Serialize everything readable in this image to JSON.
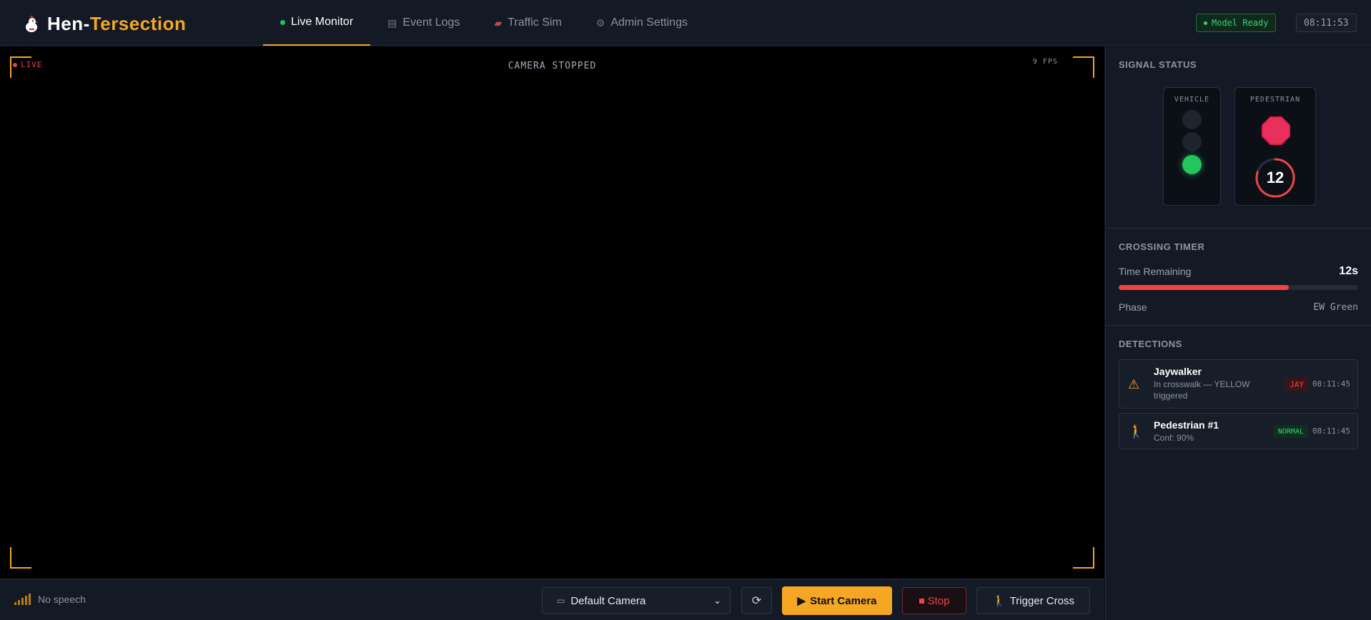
{
  "app": {
    "logo_part1": "Hen-",
    "logo_part2": "Tersection"
  },
  "nav": {
    "tabs": [
      {
        "label": "Live Monitor",
        "icon": "status-dot",
        "active": true
      },
      {
        "label": "Event Logs",
        "icon": "clipboard-icon"
      },
      {
        "label": "Traffic Sim",
        "icon": "car-icon"
      },
      {
        "label": "Admin Settings",
        "icon": "gear-icon"
      }
    ]
  },
  "header": {
    "model_status": "Model Ready",
    "clock": "08:11:53"
  },
  "feed": {
    "live_label": "LIVE",
    "status": "CAMERA STOPPED",
    "fps": "9 FPS"
  },
  "controls": {
    "speech": "No speech",
    "camera_select": "Default Camera",
    "start_label": "Start Camera",
    "stop_label": "Stop",
    "trigger_label": "Trigger Cross"
  },
  "signal": {
    "title": "SIGNAL STATUS",
    "vehicle_label": "VEHICLE",
    "vehicle_state": "green",
    "pedestrian_label": "PEDESTRIAN",
    "countdown": "12",
    "countdown_fraction": 0.8
  },
  "timer": {
    "title": "CROSSING TIMER",
    "remaining_label": "Time Remaining",
    "remaining_value": "12s",
    "progress_fraction": 0.71,
    "phase_label": "Phase",
    "phase_value": "EW Green"
  },
  "detections": {
    "title": "DETECTIONS",
    "items": [
      {
        "name": "Jaywalker",
        "sub": "In crosswalk — YELLOW triggered",
        "tag": "JAY",
        "time": "08:11:45",
        "icon": "warning-icon"
      },
      {
        "name": "Pedestrian #1",
        "sub": "Conf: 90%",
        "tag": "NORMAL",
        "time": "08:11:45",
        "icon": "pedestrian-icon"
      }
    ]
  },
  "colors": {
    "accent": "#f5a623",
    "green": "#22c55e",
    "red": "#ef4444",
    "background": "#0f141d"
  }
}
